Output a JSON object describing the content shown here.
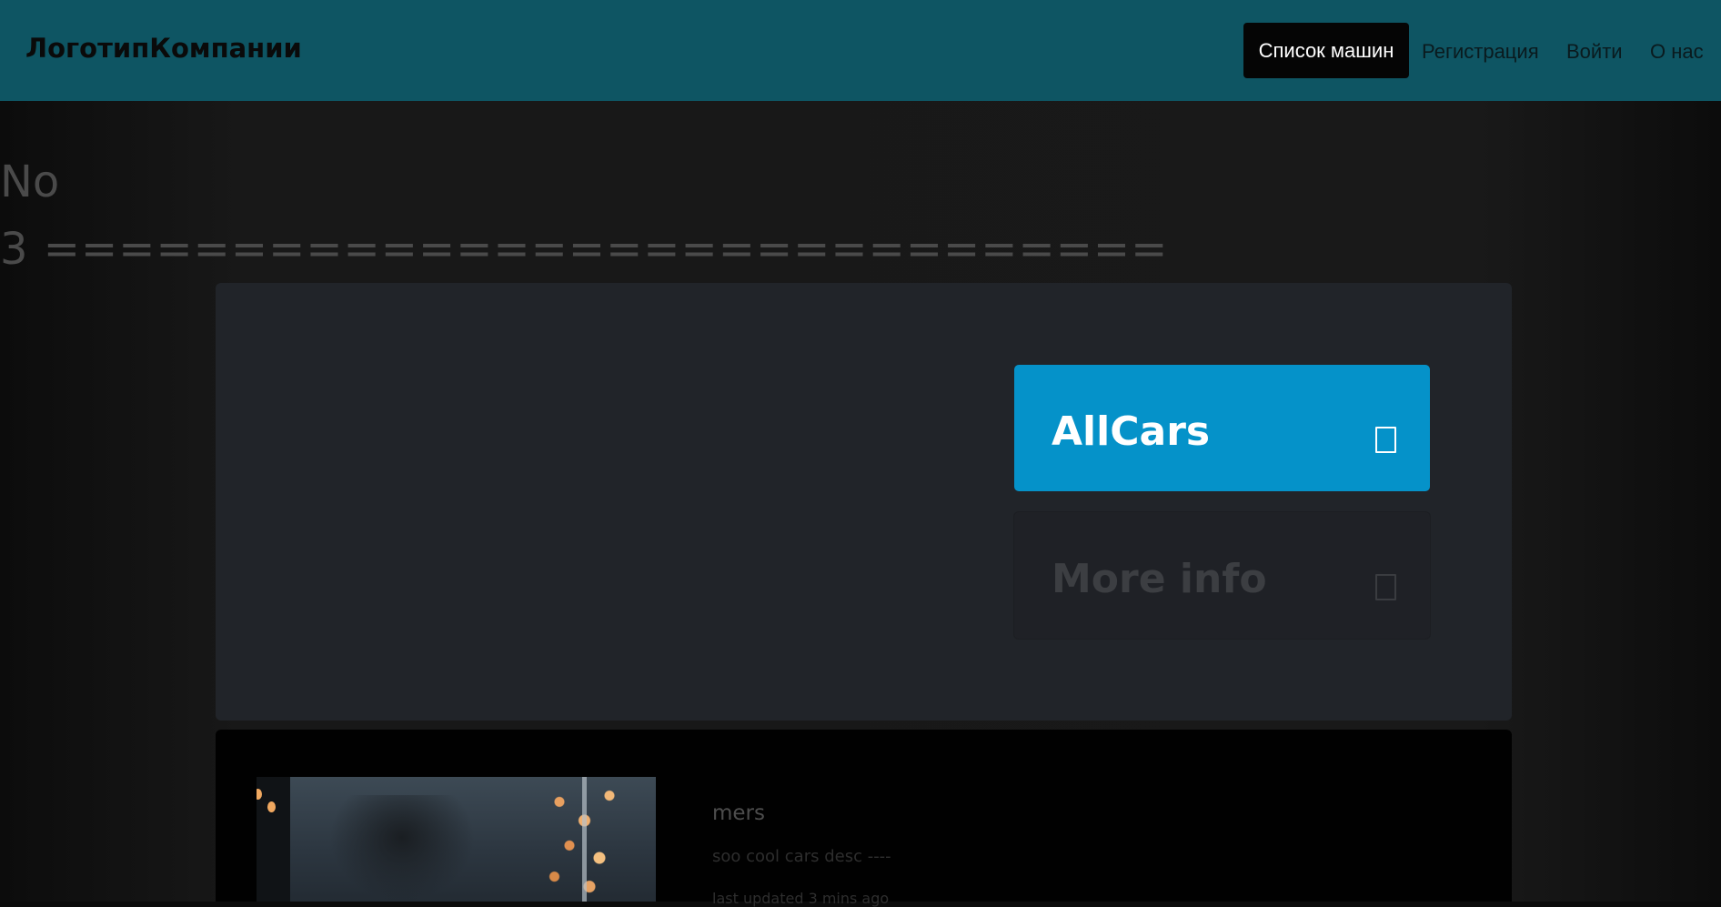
{
  "navbar": {
    "brand": "ЛоготипКомпании",
    "links": [
      {
        "label": "Список машин",
        "active": true
      },
      {
        "label": "Регистрация",
        "active": false
      },
      {
        "label": "Войти",
        "active": false
      },
      {
        "label": "О нас",
        "active": false
      }
    ],
    "background_color": "#0e5563"
  },
  "main": {
    "heading_line1": "No",
    "heading_line2": "3 ==============================",
    "tiles": [
      {
        "label": "AllCars",
        "icon": "square-icon",
        "color": "#0592c9"
      },
      {
        "label": "More info",
        "icon": "square-icon",
        "color": "#1f2126"
      }
    ]
  },
  "card": {
    "title": "mers",
    "description": "soo cool cars desc ----",
    "updated": "last updated 3 mins ago"
  },
  "colors": {
    "accent": "#0592c9",
    "panel": "#212429",
    "page": "#181818"
  }
}
